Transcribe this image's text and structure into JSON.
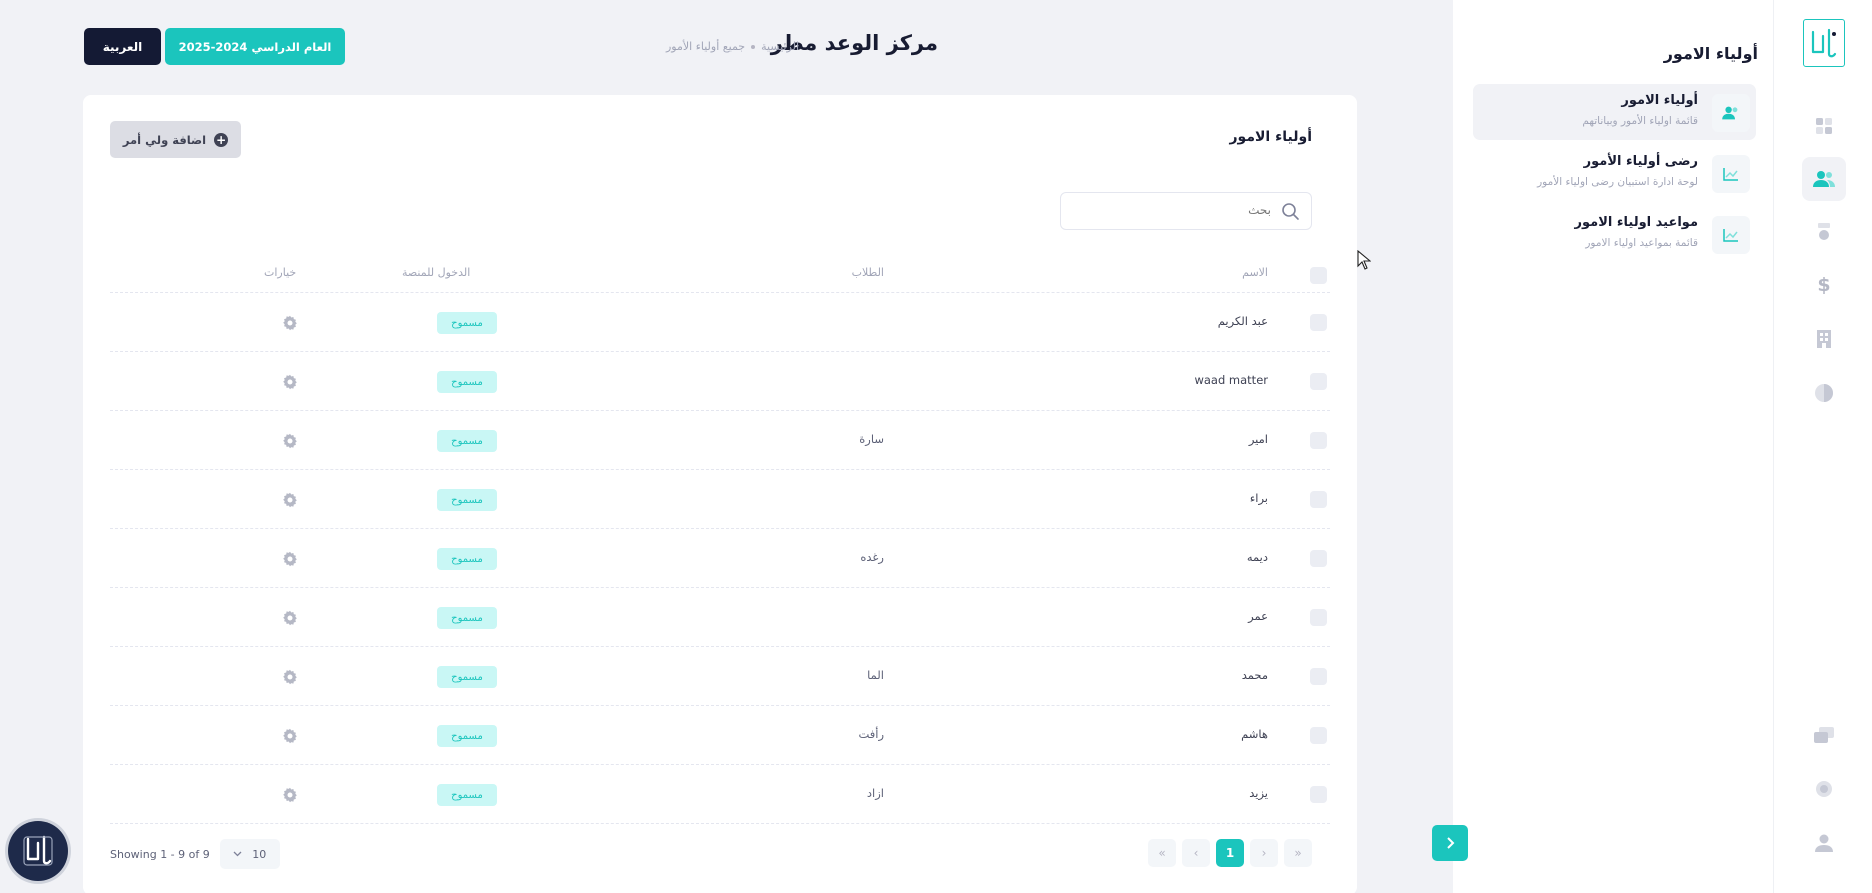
{
  "header": {
    "title": "مركز الوعد مطر",
    "breadcrumb": [
      "الرئيسية",
      "جميع أولياء الأمور"
    ],
    "language_button": "العربية",
    "year_button": "العام الدراسي 2024-2025"
  },
  "card": {
    "title": "أولياء الامور",
    "add_button": "اضافة ولي أمر",
    "search_placeholder": "بحث",
    "columns": {
      "name": "الاسم",
      "students": "الطلاب",
      "platform_access": "الدخول للمنصة",
      "options": "خيارات"
    },
    "rows": [
      {
        "name": "عبد الكريم",
        "students": "",
        "access": "مسموح"
      },
      {
        "name": "waad matter",
        "students": "",
        "access": "مسموح"
      },
      {
        "name": "امير",
        "students": "سارة",
        "access": "مسموح"
      },
      {
        "name": "براء",
        "students": "",
        "access": "مسموح"
      },
      {
        "name": "ديمه",
        "students": "رغده",
        "access": "مسموح"
      },
      {
        "name": "عمر",
        "students": "",
        "access": "مسموح"
      },
      {
        "name": "محمد",
        "students": "الما",
        "access": "مسموح"
      },
      {
        "name": "هاشم",
        "students": "رأفت",
        "access": "مسموح"
      },
      {
        "name": "يزيد",
        "students": "ازاد",
        "access": "مسموح"
      }
    ],
    "footer": {
      "showing": "Showing 1 - 9 of 9",
      "page_size": "10",
      "current_page": "1"
    }
  },
  "side_panel": {
    "title": "أولياء الامور",
    "items": [
      {
        "title": "أولياء الامور",
        "subtitle": "قائمة اولياء الأمور وبياناتهم",
        "active": true
      },
      {
        "title": "رضى أولياء الأمور",
        "subtitle": "لوحة ادارة استبيان رضى اولياء الأمور",
        "active": false
      },
      {
        "title": "مواعيد اولياء الامور",
        "subtitle": "قائمة بمواعيد اولياء الامور",
        "active": false
      }
    ]
  },
  "rail": {
    "icons": [
      "dashboard-icon",
      "users-icon",
      "award-icon",
      "dollar-icon",
      "building-icon",
      "globe-icon",
      "chat-icon",
      "settings-icon",
      "profile-icon"
    ],
    "active": "users-icon"
  },
  "colors": {
    "accent": "#1bc5bd",
    "dark": "#141a34",
    "badge_bg": "#c9f7f5"
  }
}
